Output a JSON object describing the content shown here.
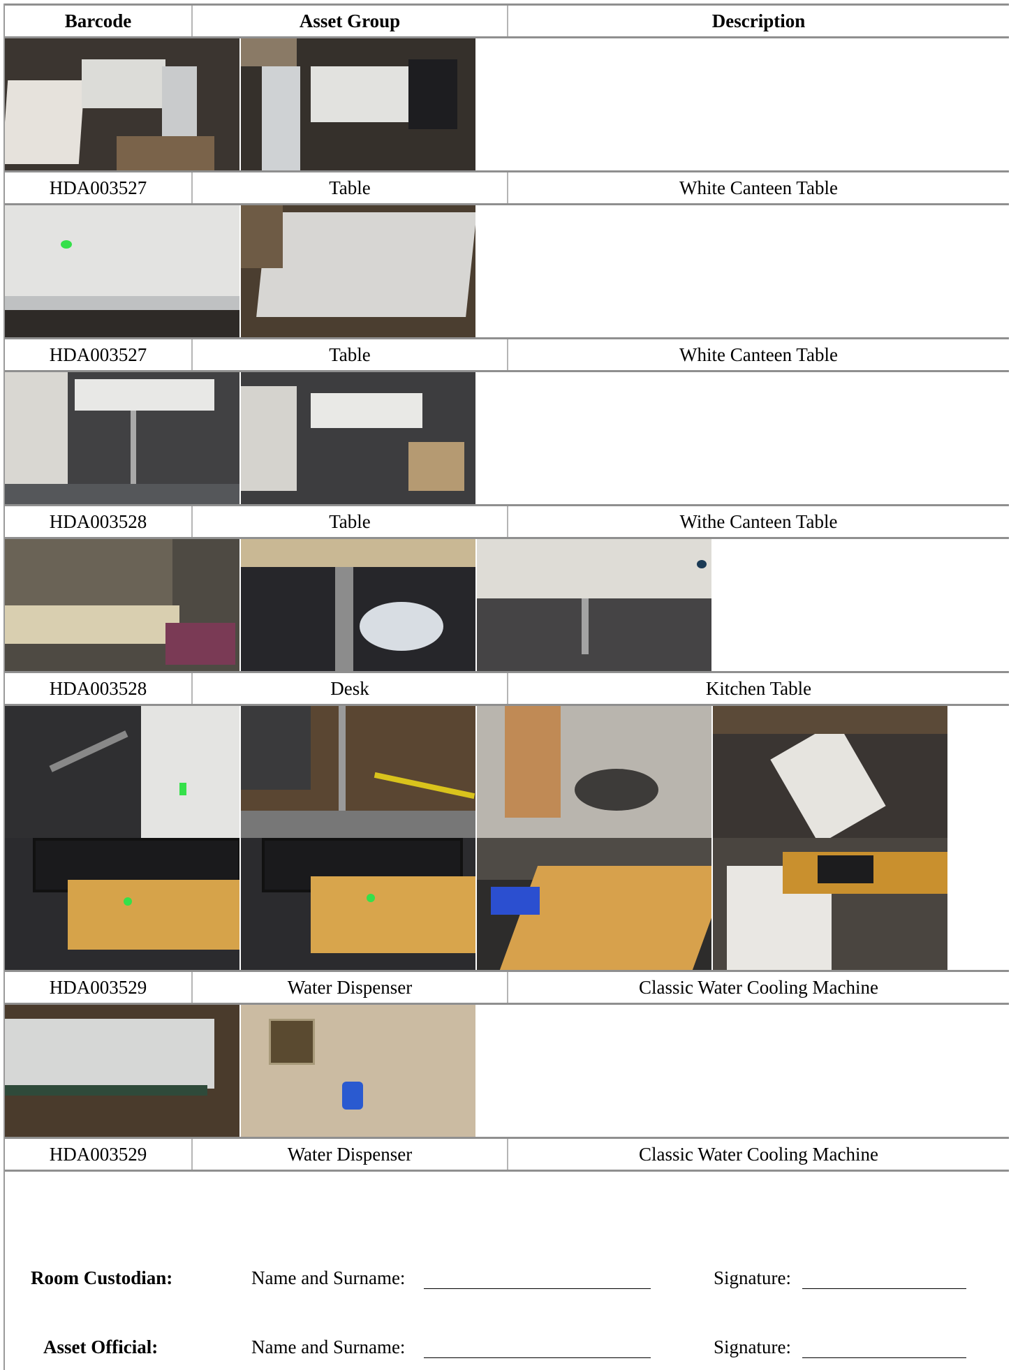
{
  "table": {
    "headers": {
      "barcode": "Barcode",
      "asset_group": "Asset Group",
      "description": "Description"
    },
    "rows": [
      {
        "barcode": "HDA003527",
        "asset_group": "Table",
        "description": "White Canteen Table"
      },
      {
        "barcode": "HDA003527",
        "asset_group": "Table",
        "description": "White Canteen Table"
      },
      {
        "barcode": "HDA003528",
        "asset_group": "Table",
        "description": "Withe Canteen Table"
      },
      {
        "barcode": "HDA003528",
        "asset_group": "Desk",
        "description": "Kitchen Table"
      },
      {
        "barcode": "HDA003529",
        "asset_group": "Water Dispenser",
        "description": "Classic Water Cooling Machine"
      },
      {
        "barcode": "HDA003529",
        "asset_group": "Water Dispenser",
        "description": "Classic Water Cooling Machine"
      }
    ]
  },
  "signatures": {
    "custodian_label": "Room Custodian:",
    "official_label": "Asset Official:",
    "name_label": "Name and Surname:",
    "signature_label": "Signature:"
  }
}
